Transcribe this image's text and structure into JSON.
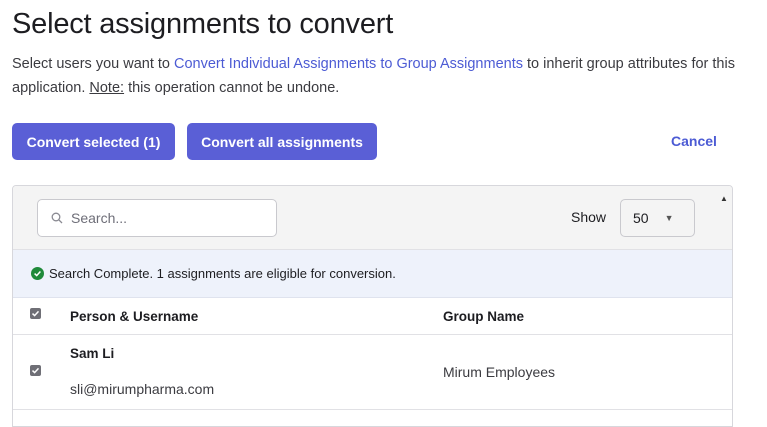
{
  "header": {
    "title": "Select assignments to convert",
    "desc_prefix": "Select users you want to ",
    "desc_link": "Convert Individual Assignments to Group Assignments",
    "desc_mid": " to inherit group attributes for this application. ",
    "note_label": "Note:",
    "desc_suffix": " this operation cannot be undone."
  },
  "actions": {
    "convert_selected": "Convert selected (1)",
    "convert_all": "Convert all assignments",
    "cancel": "Cancel"
  },
  "toolbar": {
    "search_placeholder": "Search...",
    "show_label": "Show",
    "page_size": "50"
  },
  "banner": {
    "message": "Search Complete. 1 assignments are eligible for conversion."
  },
  "table": {
    "columns": [
      "Person & Username",
      "Group Name"
    ],
    "rows": [
      {
        "selected": true,
        "name": "Sam Li",
        "username": "sli@mirumpharma.com",
        "group": "Mirum Employees"
      }
    ],
    "all_selected": true
  },
  "icons": {
    "search": "search-icon",
    "check": "check-icon",
    "success": "check-circle-icon",
    "caret": "caret-down-icon",
    "scroll": "scroll-up-arrow-icon"
  },
  "colors": {
    "primary": "#5a5fd6",
    "link": "#4c5bd4",
    "success": "#1f8a3a",
    "banner_bg": "#eef2fb"
  }
}
